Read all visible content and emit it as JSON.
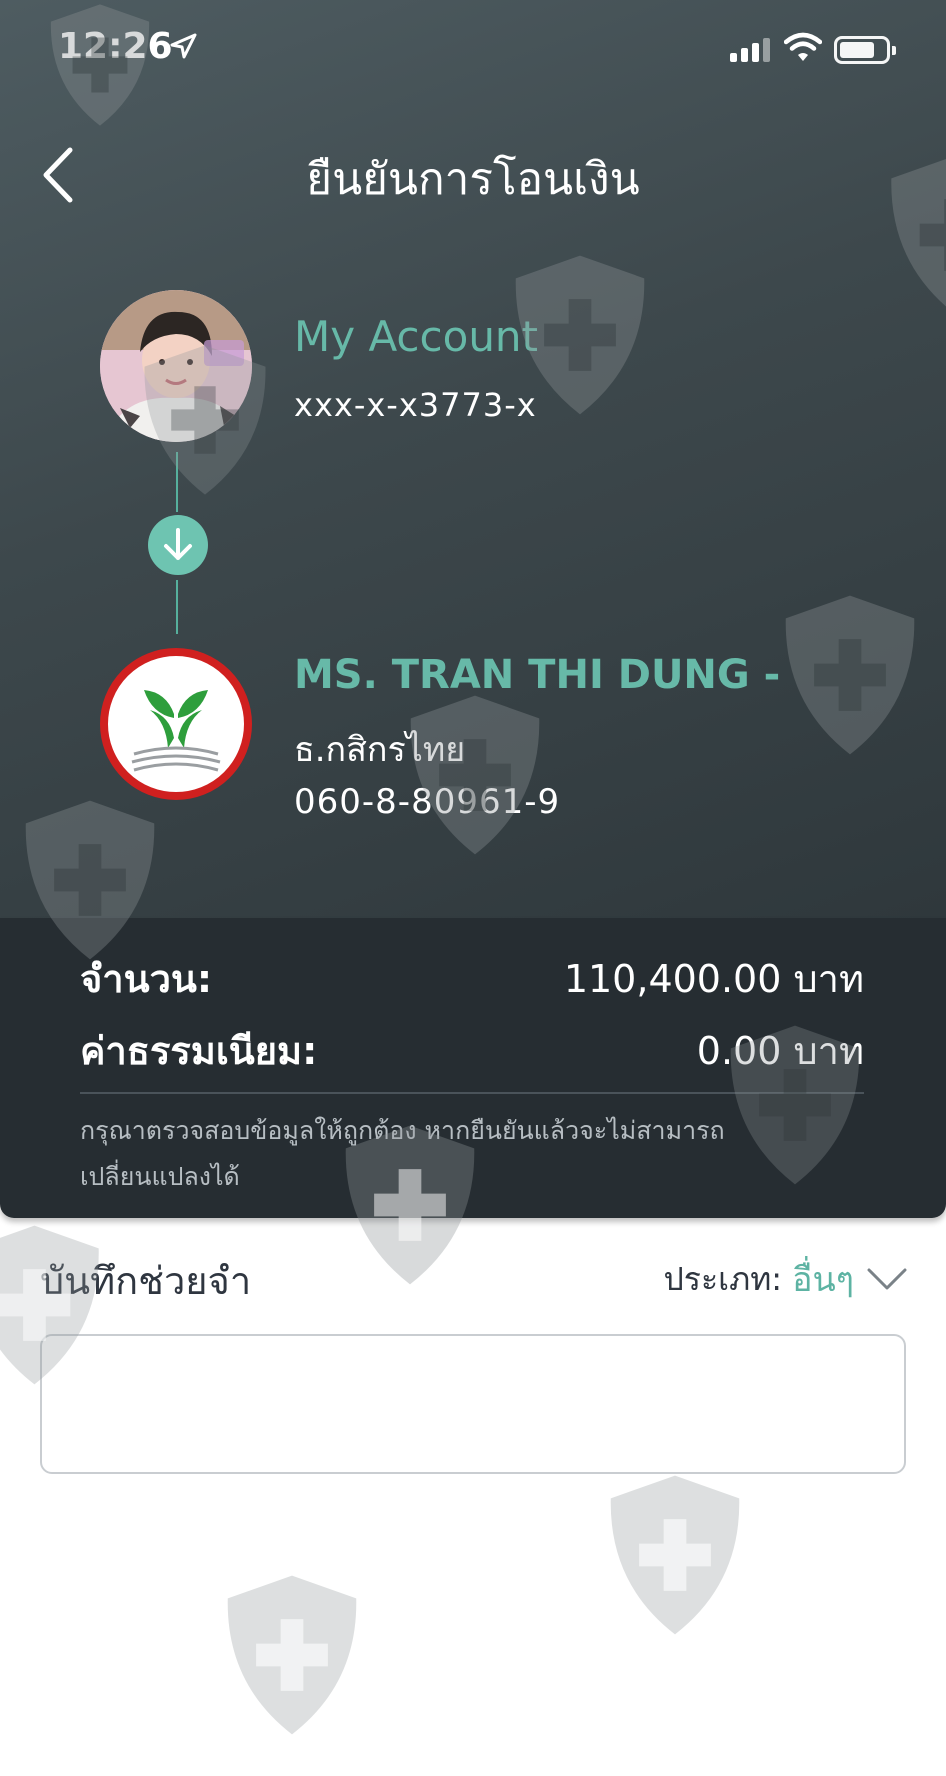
{
  "status_bar": {
    "time": "12:26"
  },
  "header": {
    "title": "ยืนยันการโอนเงิน",
    "back_icon": "chevron-left-icon"
  },
  "sender": {
    "name": "My Account",
    "account": "xxx-x-x3773-x"
  },
  "recipient": {
    "name": "MS. TRAN THI DUNG -",
    "bank": "ธ.กสิกรไทย",
    "account": "060-8-80961-9"
  },
  "summary": {
    "amount_label": "จำนวน:",
    "amount_value": "110,400.00 บาท",
    "fee_label": "ค่าธรรมเนียม:",
    "fee_value": "0.00 บาท",
    "note": "กรุณาตรวจสอบข้อมูลให้ถูกต้อง หากยืนยันแล้วจะไม่สามารถเปลี่ยนแปลงได้"
  },
  "memo": {
    "label": "บันทึกช่วยจำ",
    "type_label": "ประเภท:",
    "type_value": "อื่นๆ",
    "value": ""
  },
  "colors": {
    "accent": "#5db3a3",
    "header_bg": "#3d484c",
    "summary_bg": "#262d32",
    "bank_red": "#d0201f",
    "bank_green": "#2e9e3c"
  }
}
